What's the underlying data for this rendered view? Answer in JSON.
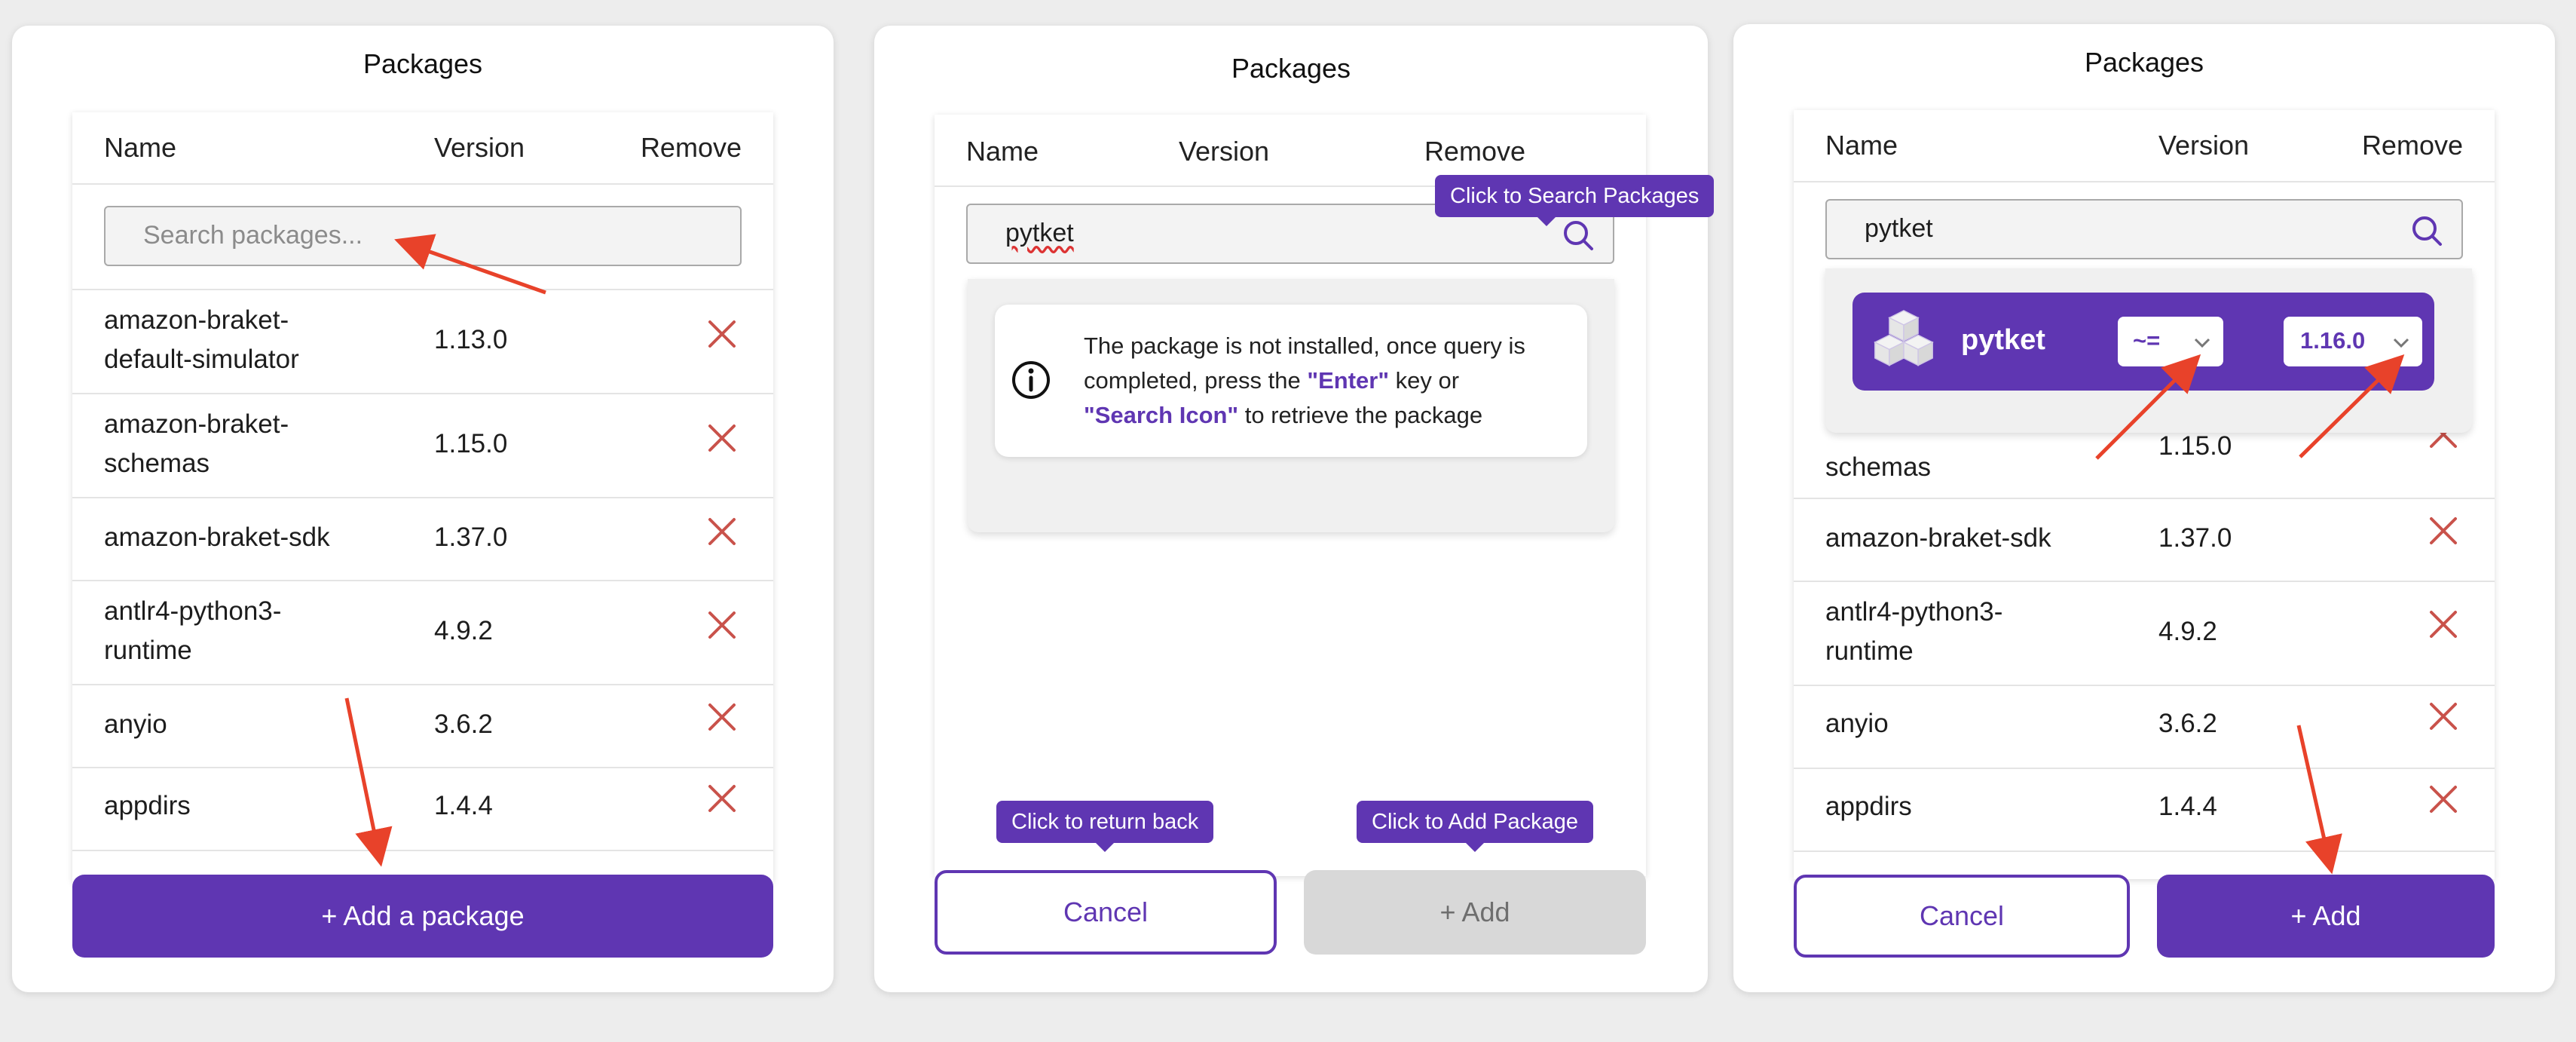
{
  "panels": [
    {
      "title": "Packages",
      "columns": {
        "name": "Name",
        "version": "Version",
        "remove": "Remove"
      },
      "search": {
        "placeholder": "Search packages..."
      },
      "rows": [
        {
          "name_line1": "amazon-braket-",
          "name_line2": "default-simulator",
          "version": "1.13.0"
        },
        {
          "name_line1": "amazon-braket-",
          "name_line2": "schemas",
          "version": "1.15.0"
        },
        {
          "name_line1": "amazon-braket-sdk",
          "name_line2": "",
          "version": "1.37.0"
        },
        {
          "name_line1": "antlr4-python3-",
          "name_line2": "runtime",
          "version": "4.9.2"
        },
        {
          "name_line1": "anyio",
          "name_line2": "",
          "version": "3.6.2"
        },
        {
          "name_line1": "appdirs",
          "name_line2": "",
          "version": "1.4.4"
        }
      ],
      "add_button": "+ Add a package"
    },
    {
      "title": "Packages",
      "columns": {
        "name": "Name",
        "version": "Version",
        "remove": "Remove"
      },
      "search": {
        "value": "pytket"
      },
      "tooltip_search": "Click to Search Packages",
      "info": {
        "line1": "The package is not installed, once query is",
        "line2_pre": "completed, press the ",
        "line2_hl": "\"Enter\"",
        "line2_post": " key or",
        "line3_hl": "\"Search Icon\"",
        "line3_post": " to retrieve the package"
      },
      "tooltip_cancel": "Click to return back",
      "tooltip_add": "Click to Add Package",
      "cancel_button": "Cancel",
      "add_button": "+ Add"
    },
    {
      "title": "Packages",
      "columns": {
        "name": "Name",
        "version": "Version",
        "remove": "Remove"
      },
      "search": {
        "value": "pytket"
      },
      "result": {
        "name": "pytket",
        "operator": "~=",
        "version": "1.16.0"
      },
      "rows": [
        {
          "name_line1": "schemas",
          "name_line2": "",
          "version": "1.15.0"
        },
        {
          "name_line1": "amazon-braket-sdk",
          "name_line2": "",
          "version": "1.37.0"
        },
        {
          "name_line1": "antlr4-python3-",
          "name_line2": "runtime",
          "version": "4.9.2"
        },
        {
          "name_line1": "anyio",
          "name_line2": "",
          "version": "3.6.2"
        },
        {
          "name_line1": "appdirs",
          "name_line2": "",
          "version": "1.4.4"
        }
      ],
      "cancel_button": "Cancel",
      "add_button": "+ Add"
    }
  ],
  "colors": {
    "accent": "#5f36b2",
    "remove": "#c9524b",
    "annotation_arrow": "#e8422a"
  },
  "icons": [
    "search-icon",
    "close-icon",
    "info-icon",
    "package-cube-icon",
    "chevron-down-icon"
  ]
}
